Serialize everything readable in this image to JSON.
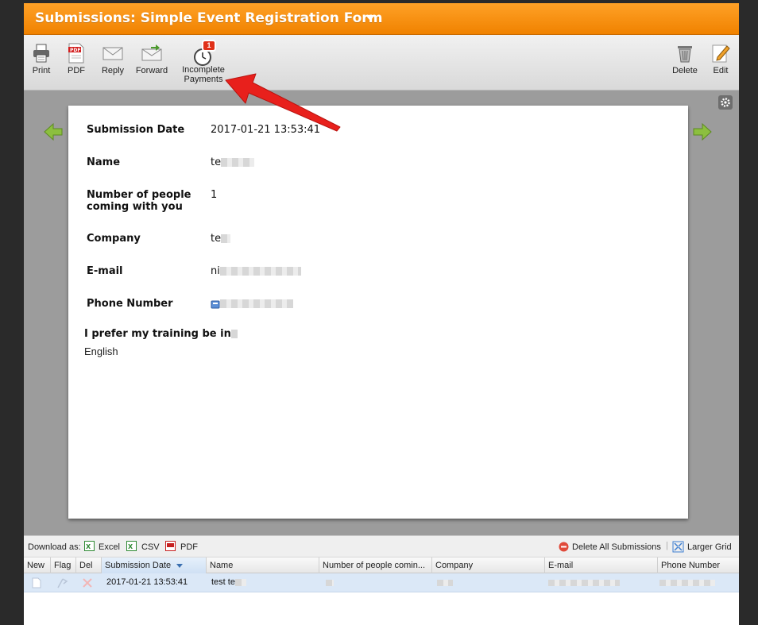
{
  "window": {
    "title": "Submissions: Simple Event Registration Form"
  },
  "toolbar": {
    "print": "Print",
    "pdf": "PDF",
    "reply": "Reply",
    "forward": "Forward",
    "incomplete_line1": "Incomplete",
    "incomplete_line2": "Payments",
    "incomplete_badge": "1",
    "delete": "Delete",
    "edit": "Edit"
  },
  "submission": {
    "fields": [
      {
        "label": "Submission Date",
        "value": "2017-01-21 13:53:41"
      },
      {
        "label": "Name",
        "value": "te"
      },
      {
        "label": "Number of people coming with you",
        "value": "1"
      },
      {
        "label": "Company",
        "value": "te"
      },
      {
        "label": "E-mail",
        "value": "ni"
      },
      {
        "label": "Phone Number",
        "value": ""
      }
    ],
    "preference_label": "I prefer my training be in",
    "preference_value": "English"
  },
  "download_bar": {
    "label": "Download as:",
    "excel": "Excel",
    "csv": "CSV",
    "pdf": "PDF",
    "delete_all": "Delete All Submissions",
    "larger_grid": "Larger Grid"
  },
  "grid": {
    "columns": [
      "New",
      "Flag",
      "Del",
      "Submission Date",
      "Name",
      "Number of people comin...",
      "Company",
      "E-mail",
      "Phone Number"
    ],
    "rows": [
      {
        "date": "2017-01-21 13:53:41",
        "name": "test te"
      }
    ]
  },
  "colors": {
    "accent": "#f08200",
    "annotation_arrow": "#e8201c",
    "selected_row": "#dbe8f7"
  }
}
